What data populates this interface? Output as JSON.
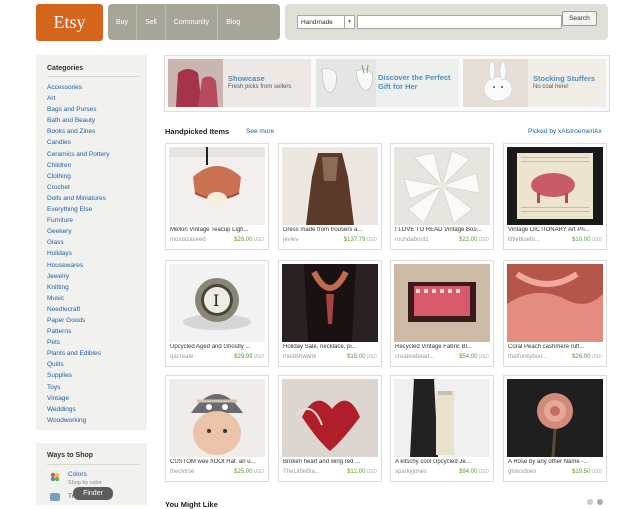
{
  "header": {
    "logo": "Etsy",
    "nav": [
      "Buy",
      "Sell",
      "Community",
      "Blog"
    ],
    "search_category": "Handmade",
    "search_placeholder": "",
    "search_button": "Search"
  },
  "sidebar": {
    "categories_title": "Categories",
    "categories": [
      "Accessories",
      "Art",
      "Bags and Purses",
      "Bath and Beauty",
      "Books and Zines",
      "Candles",
      "Ceramics and Pottery",
      "Children",
      "Clothing",
      "Crochet",
      "Dolls and Miniatures",
      "Everything Else",
      "Furniture",
      "Geekery",
      "Glass",
      "Holidays",
      "Housewares",
      "Jewelry",
      "Knitting",
      "Music",
      "Needlecraft",
      "Paper Goods",
      "Patterns",
      "Pets",
      "Plants and Edibles",
      "Quilts",
      "Supplies",
      "Toys",
      "Vintage",
      "Weddings",
      "Woodworking"
    ],
    "ways_title": "Ways to Shop",
    "ways": [
      {
        "label": "Colors",
        "sub": "Shop by color",
        "icon": "color-wheel-icon"
      },
      {
        "label": "Treasury",
        "icon": "treasury-icon"
      }
    ],
    "finder_tooltip": "Finder"
  },
  "featured": [
    {
      "title": "Showcase",
      "subtitle": "Fresh picks from sellers",
      "color": "#4d8fc0"
    },
    {
      "title": "Discover the Perfect",
      "title2": "Gift for Her",
      "color": "#4d8fc0"
    },
    {
      "title": "Stocking Stuffers",
      "subtitle": "No coal here!",
      "color": "#4d8fc0"
    }
  ],
  "handpicked": {
    "title": "Handpicked Items",
    "see_more": "See more",
    "picked_by": "Picked by xAlstroemeriAx",
    "items": [
      {
        "title": "Mellon Vintage Teacup Ligh...",
        "shop": "mostazaseed",
        "price": "$28.00",
        "currency": "USD"
      },
      {
        "title": "Dress made from trousers a...",
        "shop": "jeviev",
        "price": "$137.79",
        "currency": "USD"
      },
      {
        "title": "I LOVE TO READ Vintage Boo...",
        "shop": "roundabout1",
        "price": "$22.00",
        "currency": "USD"
      },
      {
        "title": "Vintage DICTIONARY Art Pri...",
        "shop": "littlebluebi...",
        "price": "$10.00",
        "currency": "USD"
      },
      {
        "title": "Upcycled Aged and Ghostly ...",
        "shop": "qacreate",
        "price": "$29.99",
        "currency": "USD"
      },
      {
        "title": "Holiday Sale, necklace, pi...",
        "shop": "modishwank",
        "price": "$15.00",
        "currency": "USD"
      },
      {
        "title": "Recycled Vintage Fabric Bl...",
        "shop": "creativebead...",
        "price": "$54.00",
        "currency": "USD"
      },
      {
        "title": "Coral Peach cashmere ruff...",
        "shop": "thatfunkybou...",
        "price": "$26.00",
        "currency": "USD"
      },
      {
        "title": "CUSTOM wee hOOt Hat. an u...",
        "shop": "thecktrse",
        "price": "$25.00",
        "currency": "USD"
      },
      {
        "title": "Broken heart and wing red ...",
        "shop": "TheLittleBla...",
        "price": "$12.00",
        "currency": "USD"
      },
      {
        "title": "A kitschy cool Upcycled Je...",
        "shop": "sparkyjones",
        "price": "$94.00",
        "currency": "USD"
      },
      {
        "title": "A Rose by any other Name -...",
        "shop": "glowsdoes",
        "price": "$19.50",
        "currency": "USD"
      }
    ]
  },
  "you_might_like": "You Might Like"
}
